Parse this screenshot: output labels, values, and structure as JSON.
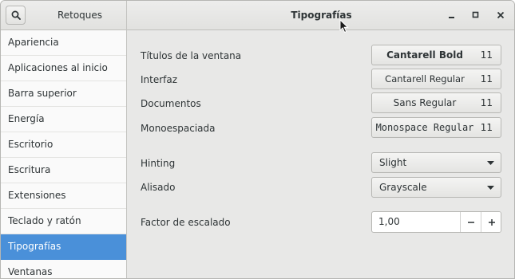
{
  "header": {
    "app_title": "Retoques",
    "page_title": "Tipografías",
    "search_icon": "search-icon",
    "window_controls": [
      "minimize-icon",
      "maximize-icon",
      "close-icon"
    ]
  },
  "sidebar": {
    "items": [
      {
        "label": "Apariencia"
      },
      {
        "label": "Aplicaciones al inicio"
      },
      {
        "label": "Barra superior"
      },
      {
        "label": "Energía"
      },
      {
        "label": "Escritorio"
      },
      {
        "label": "Escritura"
      },
      {
        "label": "Extensiones"
      },
      {
        "label": "Teclado y ratón"
      },
      {
        "label": "Tipografías"
      },
      {
        "label": "Ventanas"
      }
    ],
    "selected": "Tipografías"
  },
  "fonts": {
    "window_titles": {
      "label": "Títulos de la ventana",
      "font": "Cantarell Bold",
      "size": "11"
    },
    "interface": {
      "label": "Interfaz",
      "font": "Cantarell Regular",
      "size": "11"
    },
    "documents": {
      "label": "Documentos",
      "font": "Sans Regular",
      "size": "11"
    },
    "monospace": {
      "label": "Monoespaciada",
      "font": "Monospace Regular",
      "size": "11"
    }
  },
  "rendering": {
    "hinting": {
      "label": "Hinting",
      "value": "Slight"
    },
    "antialiasing": {
      "label": "Alisado",
      "value": "Grayscale"
    }
  },
  "scaling": {
    "label": "Factor de escalado",
    "value": "1,00"
  },
  "colors": {
    "selection": "#4a90d9",
    "background": "#e8e8e7",
    "sidebar": "#fafafa"
  }
}
